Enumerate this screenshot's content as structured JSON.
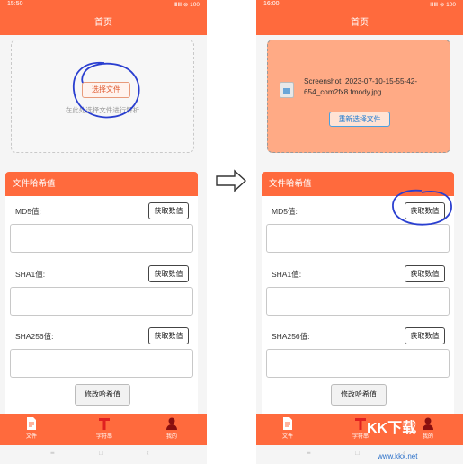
{
  "left": {
    "status": {
      "time": "15:50",
      "icons": "ⅢⅢ ⊜ 100"
    },
    "header": {
      "title": "首页"
    },
    "upload": {
      "select_label": "选择文件",
      "hint": "在此处选择文件进行解析"
    },
    "card": {
      "title": "文件哈希值",
      "md5_label": "MD5值:",
      "sha1_label": "SHA1值:",
      "sha256_label": "SHA256值:",
      "get_label": "获取数值",
      "modify_label": "修改哈希值"
    },
    "tabs": [
      {
        "label": "文件"
      },
      {
        "label": "字符串"
      },
      {
        "label": "我的"
      }
    ]
  },
  "right": {
    "status": {
      "time": "16:00",
      "icons": "ⅢⅢ ⊜ 100"
    },
    "header": {
      "title": "首页"
    },
    "upload": {
      "filename": "Screenshot_2023-07-10-15-55-42-654_com2fx8.fmody.jpg",
      "reselect_label": "重新选择文件"
    },
    "card": {
      "title": "文件哈希值",
      "md5_label": "MD5值:",
      "sha1_label": "SHA1值:",
      "sha256_label": "SHA256值:",
      "get_label": "获取数值",
      "modify_label": "修改哈希值"
    },
    "tabs": [
      {
        "label": "文件"
      },
      {
        "label": "字符串"
      },
      {
        "label": "我的"
      }
    ]
  },
  "watermark": {
    "text": "KK下载",
    "url": "www.kkx.net"
  },
  "colors": {
    "accent": "#ff6a3d",
    "upload_filled": "#ffaa85",
    "link_blue": "#1f7ad0",
    "scribble": "#2a3fd0"
  }
}
